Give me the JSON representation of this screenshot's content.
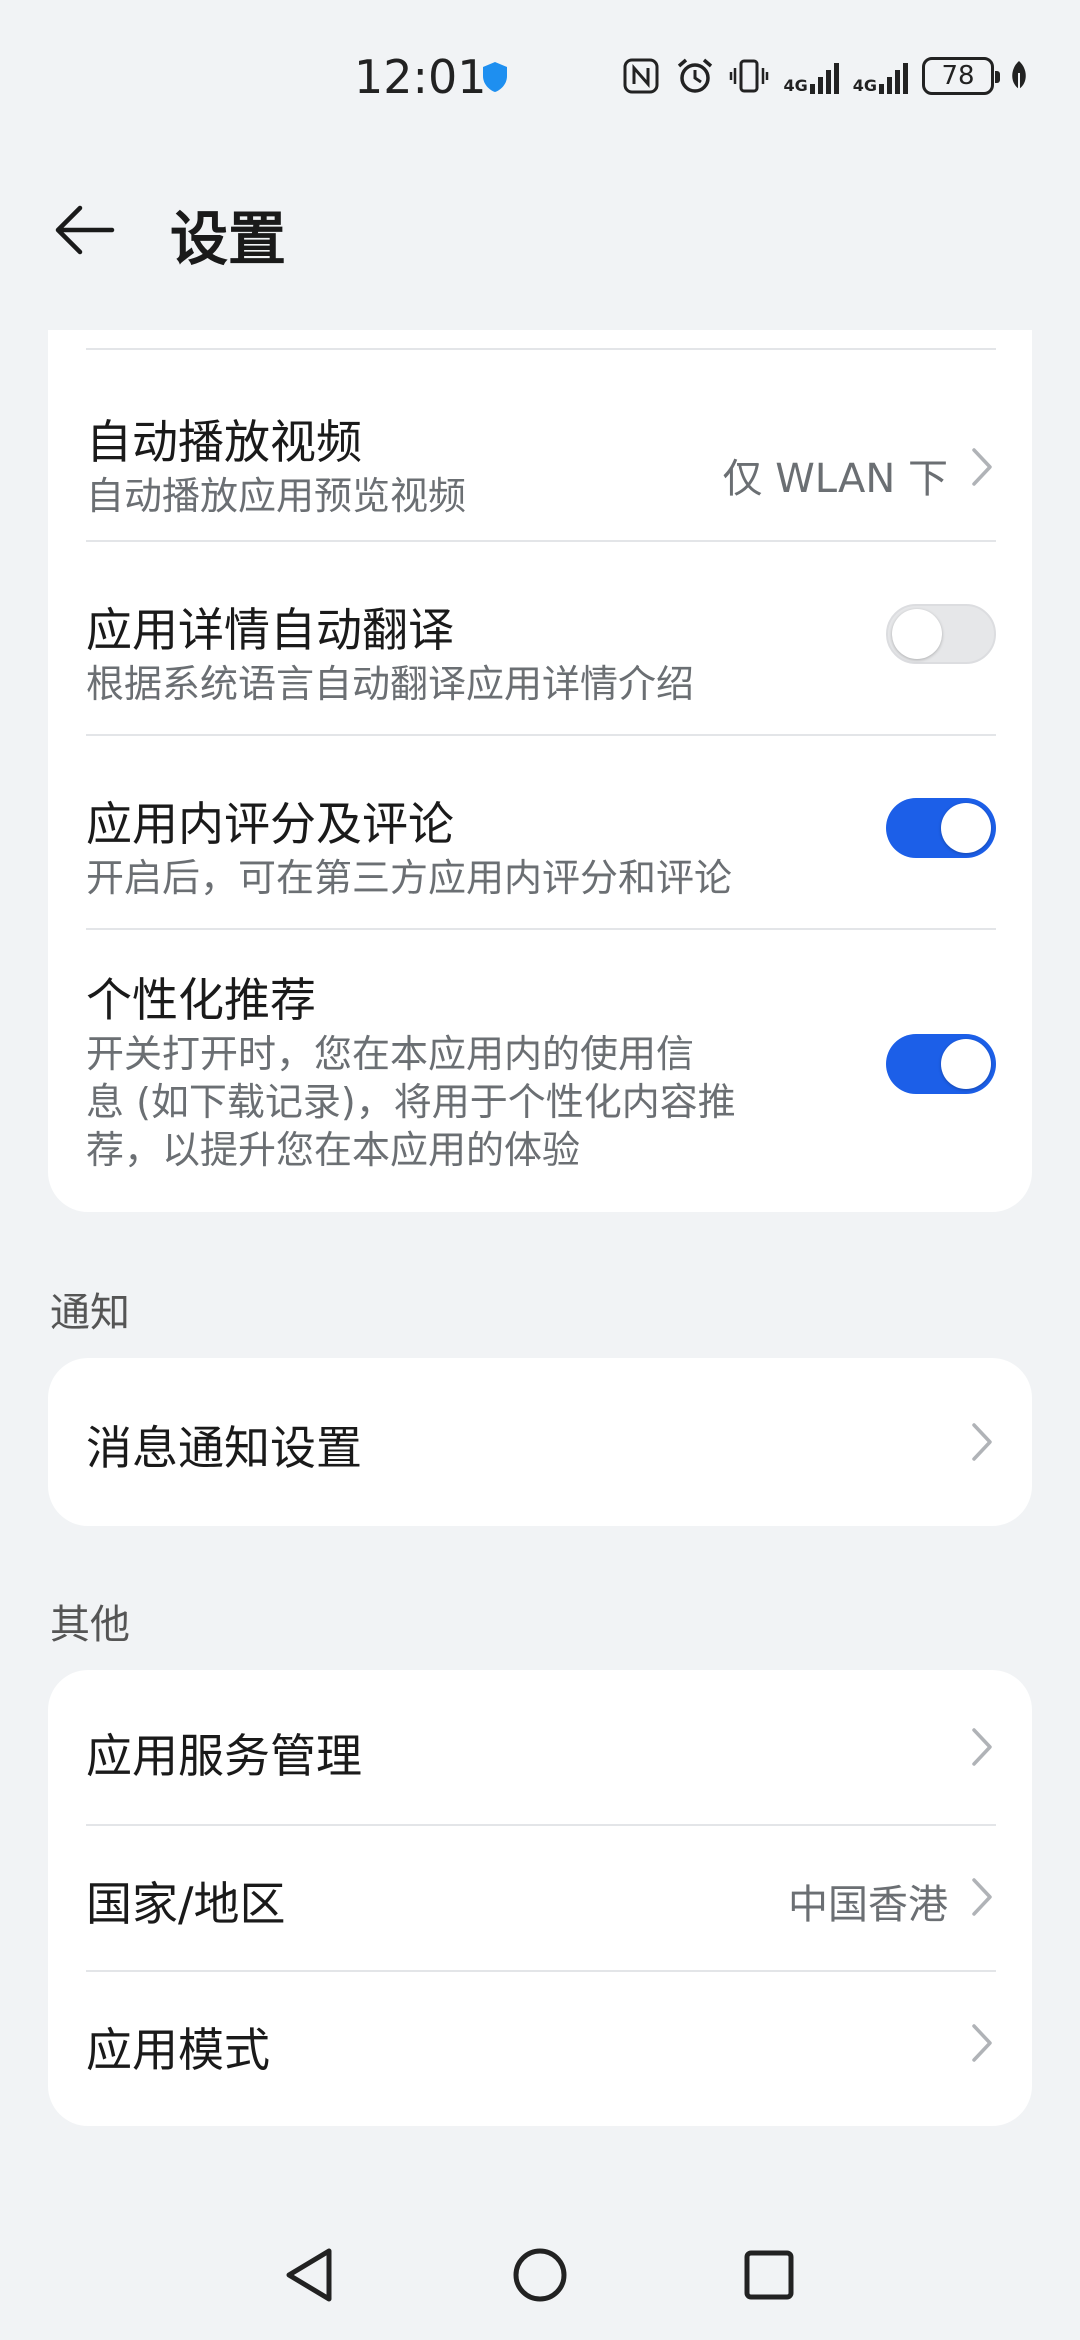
{
  "status_bar": {
    "time": "12:01",
    "network_1": "4G",
    "network_2": "4G",
    "battery": "78",
    "icons": [
      "shield-icon",
      "nfc-icon",
      "alarm-icon",
      "vibrate-icon",
      "signal-icon",
      "battery-icon",
      "leaf-icon"
    ]
  },
  "header": {
    "title": "设置",
    "back_icon": "arrow-left-icon"
  },
  "settings": {
    "autoplay": {
      "title": "自动播放视频",
      "subtitle": "自动播放应用预览视频",
      "value": "仅 WLAN 下"
    },
    "translate": {
      "title": "应用详情自动翻译",
      "subtitle": "根据系统语言自动翻译应用详情介绍",
      "enabled": false
    },
    "ratings": {
      "title": "应用内评分及评论",
      "subtitle": "开启后，可在第三方应用内评分和评论",
      "enabled": true
    },
    "personalized": {
      "title": "个性化推荐",
      "subtitle_lines": [
        "开关打开时，您在本应用内的使用信",
        "息 (如下载记录)，将用于个性化内容推",
        "荐，以提升您在本应用的体验"
      ],
      "enabled": true
    }
  },
  "notification_section": {
    "label": "通知",
    "items": [
      {
        "title": "消息通知设置"
      }
    ]
  },
  "other_section": {
    "label": "其他",
    "items": [
      {
        "title": "应用服务管理",
        "value": ""
      },
      {
        "title": "国家/地区",
        "value": "中国香港"
      },
      {
        "title": "应用模式",
        "value": ""
      }
    ]
  },
  "colors": {
    "accent": "#1c5fe8",
    "background": "#f1f3f5",
    "card": "#ffffff"
  }
}
